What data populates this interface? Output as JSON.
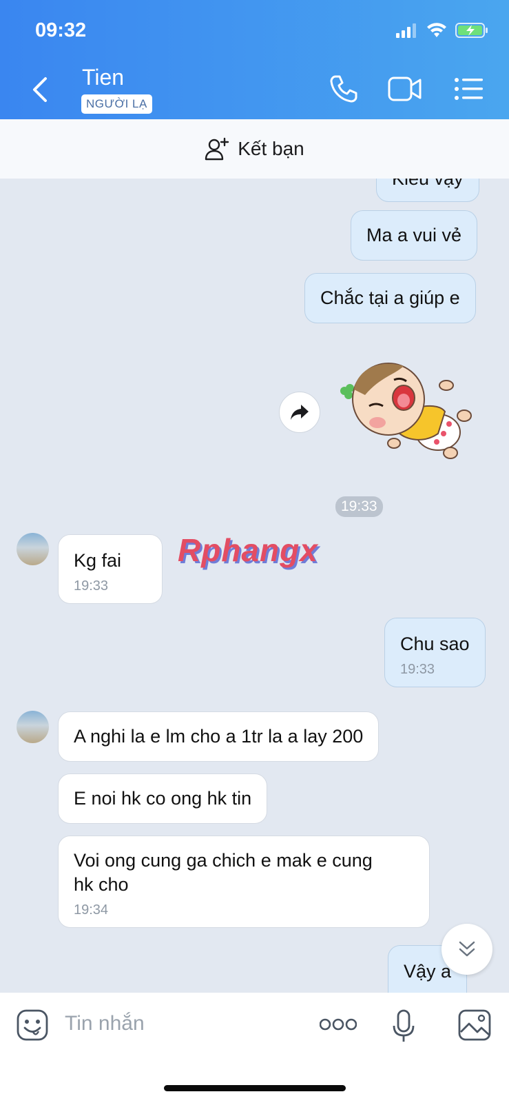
{
  "status": {
    "time": "09:32"
  },
  "header": {
    "contact_name": "Tien",
    "badge": "NGƯỜI LẠ"
  },
  "add_friend": {
    "label": "Kết bạn"
  },
  "messages": {
    "m0": "Kiểu vậy",
    "m1": "Ma a vui vẻ",
    "m2": "Chắc tại a giúp e",
    "sticker_time": "19:33",
    "m3": {
      "text": "Kg fai",
      "time": "19:33"
    },
    "m4": {
      "text": "Chu sao",
      "time": "19:33"
    },
    "m5": "A nghi la e lm cho a 1tr la a lay 200",
    "m6": "E noi hk co ong hk tin",
    "m7": {
      "line1": "Voi ong cung ga chich e mak e cung",
      "line2": "hk cho",
      "time": "19:34"
    },
    "m8": "Vậy a"
  },
  "watermark": "Rphangx",
  "input": {
    "placeholder": "Tin nhắn"
  },
  "colors": {
    "header_start": "#3a86f0",
    "header_end": "#4aa6ef",
    "my_bubble": "#dcecfb",
    "chat_bg": "#e2e8f1"
  }
}
